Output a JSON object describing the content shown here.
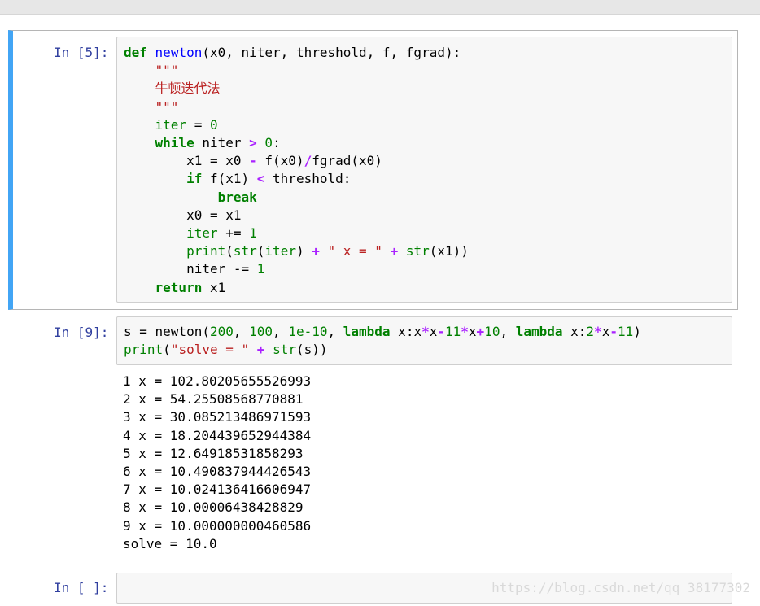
{
  "cells": [
    {
      "prompt": "In [5]:",
      "lines": [
        [
          [
            "kw",
            "def"
          ],
          [
            "t",
            " "
          ],
          [
            "def",
            "newton"
          ],
          [
            "t",
            "(x0, niter, threshold, f, fgrad):"
          ]
        ],
        [
          [
            "t",
            "    "
          ],
          [
            "str",
            "\"\"\""
          ]
        ],
        [
          [
            "t",
            "    "
          ],
          [
            "str",
            "牛顿迭代法"
          ]
        ],
        [
          [
            "t",
            "    "
          ],
          [
            "str",
            "\"\"\""
          ]
        ],
        [
          [
            "t",
            "    "
          ],
          [
            "bi",
            "iter"
          ],
          [
            "t",
            " = "
          ],
          [
            "num",
            "0"
          ]
        ],
        [
          [
            "t",
            "    "
          ],
          [
            "kw",
            "while"
          ],
          [
            "t",
            " niter "
          ],
          [
            "op",
            ">"
          ],
          [
            "t",
            " "
          ],
          [
            "num",
            "0"
          ],
          [
            "t",
            ":"
          ]
        ],
        [
          [
            "t",
            "        x1 = x0 "
          ],
          [
            "op",
            "-"
          ],
          [
            "t",
            " f(x0)"
          ],
          [
            "op",
            "/"
          ],
          [
            "t",
            "fgrad(x0)"
          ]
        ],
        [
          [
            "t",
            "        "
          ],
          [
            "kw",
            "if"
          ],
          [
            "t",
            " f(x1) "
          ],
          [
            "op",
            "<"
          ],
          [
            "t",
            " threshold:"
          ]
        ],
        [
          [
            "t",
            "            "
          ],
          [
            "kw",
            "break"
          ]
        ],
        [
          [
            "t",
            "        x0 = x1"
          ]
        ],
        [
          [
            "t",
            "        "
          ],
          [
            "bi",
            "iter"
          ],
          [
            "t",
            " += "
          ],
          [
            "num",
            "1"
          ]
        ],
        [
          [
            "t",
            "        "
          ],
          [
            "bi",
            "print"
          ],
          [
            "t",
            "("
          ],
          [
            "bi",
            "str"
          ],
          [
            "t",
            "("
          ],
          [
            "bi",
            "iter"
          ],
          [
            "t",
            ") "
          ],
          [
            "op",
            "+"
          ],
          [
            "t",
            " "
          ],
          [
            "str",
            "\" x = \""
          ],
          [
            "t",
            " "
          ],
          [
            "op",
            "+"
          ],
          [
            "t",
            " "
          ],
          [
            "bi",
            "str"
          ],
          [
            "t",
            "(x1))"
          ]
        ],
        [
          [
            "t",
            "        niter -= "
          ],
          [
            "num",
            "1"
          ]
        ],
        [
          [
            "t",
            "    "
          ],
          [
            "kw",
            "return"
          ],
          [
            "t",
            " x1"
          ]
        ]
      ]
    },
    {
      "prompt": "In [9]:",
      "lines": [
        [
          [
            "t",
            "s = newton("
          ],
          [
            "num",
            "200"
          ],
          [
            "t",
            ", "
          ],
          [
            "num",
            "100"
          ],
          [
            "t",
            ", "
          ],
          [
            "num",
            "1e-10"
          ],
          [
            "t",
            ", "
          ],
          [
            "kw",
            "lambda"
          ],
          [
            "t",
            " x:x"
          ],
          [
            "op",
            "*"
          ],
          [
            "t",
            "x"
          ],
          [
            "op",
            "-"
          ],
          [
            "num",
            "11"
          ],
          [
            "op",
            "*"
          ],
          [
            "t",
            "x"
          ],
          [
            "op",
            "+"
          ],
          [
            "num",
            "10"
          ],
          [
            "t",
            ", "
          ],
          [
            "kw",
            "lambda"
          ],
          [
            "t",
            " x:"
          ],
          [
            "num",
            "2"
          ],
          [
            "op",
            "*"
          ],
          [
            "t",
            "x"
          ],
          [
            "op",
            "-"
          ],
          [
            "num",
            "11"
          ],
          [
            "t",
            ")"
          ]
        ],
        [
          [
            "bi",
            "print"
          ],
          [
            "t",
            "("
          ],
          [
            "str",
            "\"solve = \""
          ],
          [
            "t",
            " "
          ],
          [
            "op",
            "+"
          ],
          [
            "t",
            " "
          ],
          [
            "bi",
            "str"
          ],
          [
            "t",
            "(s))"
          ]
        ]
      ],
      "output": [
        "1 x = 102.80205655526993",
        "2 x = 54.25508568770881",
        "3 x = 30.085213486971593",
        "4 x = 18.204439652944384",
        "5 x = 12.64918531858293",
        "6 x = 10.490837944426543",
        "7 x = 10.024136416606947",
        "8 x = 10.00006438428829",
        "9 x = 10.000000000460586",
        "solve = 10.0"
      ]
    },
    {
      "prompt": "In [ ]:",
      "lines": []
    }
  ],
  "watermark": "https://blog.csdn.net/qq_38177302"
}
